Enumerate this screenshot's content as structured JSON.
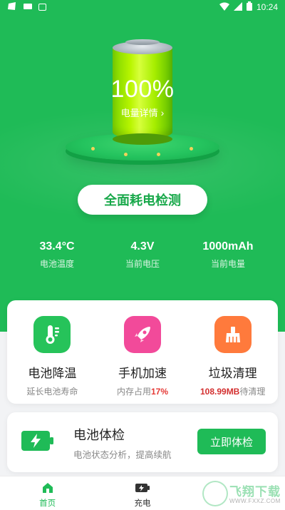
{
  "status_bar": {
    "time": "10:24",
    "icons": [
      "app-notification-icon",
      "mail-icon",
      "a-icon",
      "wifi-icon",
      "signal-icon",
      "battery-icon"
    ]
  },
  "hero": {
    "battery_percent": "100%",
    "detail_label": "电量详情",
    "detail_chevron": "›",
    "check_button": "全面耗电检测"
  },
  "stats": [
    {
      "value": "33.4°C",
      "label": "电池温度"
    },
    {
      "value": "4.3V",
      "label": "当前电压"
    },
    {
      "value": "1000mAh",
      "label": "当前电量"
    }
  ],
  "tools": [
    {
      "title": "电池降温",
      "sub": "延长电池寿命",
      "highlight": "",
      "sub_after": "",
      "icon": "thermometer-icon",
      "color": "#26c35a"
    },
    {
      "title": "手机加速",
      "sub": "内存占用",
      "highlight": "17%",
      "sub_after": "",
      "icon": "rocket-icon",
      "color": "#f24a9a"
    },
    {
      "title": "垃圾清理",
      "sub": "",
      "highlight": "108.99MB",
      "sub_after": "待清理",
      "icon": "broom-icon",
      "color": "#ff7a3c"
    }
  ],
  "exam": {
    "title": "电池体检",
    "subtitle": "电池状态分析，提高续航",
    "button": "立即体检"
  },
  "tabs": [
    {
      "label": "首页",
      "icon": "home-icon",
      "active": true
    },
    {
      "label": "充电",
      "icon": "charge-icon",
      "active": false
    },
    {
      "label": "",
      "icon": "more-icon",
      "active": false
    }
  ],
  "watermark": {
    "text": "飞翔下载",
    "url": "WWW.FXXZ.COM"
  },
  "colors": {
    "primary": "#1fbb57",
    "warning": "#e53935"
  }
}
